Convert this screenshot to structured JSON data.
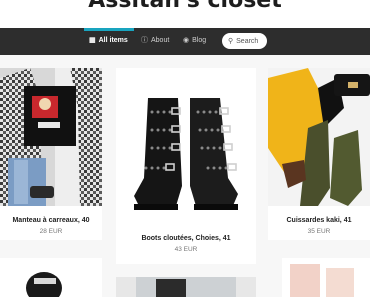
{
  "header": {
    "site_title": "Assitan's closet"
  },
  "nav": {
    "items": [
      {
        "label": "All items",
        "icon": "grid-icon",
        "active": true
      },
      {
        "label": "About",
        "icon": "info-icon"
      },
      {
        "label": "Blog",
        "icon": "globe-icon"
      }
    ],
    "search_label": "Search"
  },
  "products": [
    {
      "title": "Manteau à carreaux, 40",
      "price": "28 EUR"
    },
    {
      "title": "Boots cloutées, Choies, 41",
      "price": "43 EUR"
    },
    {
      "title": "Cuissardes kaki, 41",
      "price": "35 EUR"
    }
  ],
  "colors": {
    "nav_bg": "#2d2d2d",
    "accent": "#19a4bf"
  }
}
